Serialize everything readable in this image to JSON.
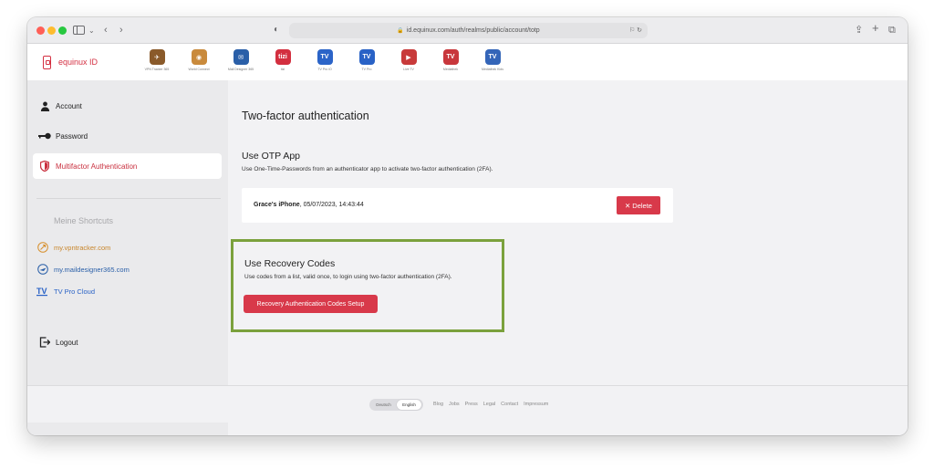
{
  "browser": {
    "url": "id.equinux.com/auth/realms/public/account/totp",
    "translate_icon": "translate-icon",
    "reload_icon": "reload-icon"
  },
  "header": {
    "brand": "equinux ID",
    "apps": [
      {
        "label": "VPN Tracker 365",
        "color": "#8a5a2a",
        "glyph": "✈"
      },
      {
        "label": "World Connect",
        "color": "#c98a3c",
        "glyph": "◉"
      },
      {
        "label": "Mail Designer 365",
        "color": "#2a5fa8",
        "glyph": "✉"
      },
      {
        "label": "tizi",
        "color": "#d32f3f",
        "glyph": "tizi"
      },
      {
        "label": "TV Pro iO",
        "color": "#2b64c8",
        "glyph": "TV"
      },
      {
        "label": "TV Pro",
        "color": "#2962c6",
        "glyph": "TV"
      },
      {
        "label": "Live TV",
        "color": "#c83a3a",
        "glyph": "▶"
      },
      {
        "label": "Mediathek",
        "color": "#c8373c",
        "glyph": "TV"
      },
      {
        "label": "Mediathek Kids",
        "color": "#3465b8",
        "glyph": "TV"
      }
    ]
  },
  "sidebar": {
    "items": [
      {
        "label": "Account",
        "icon": "person-icon"
      },
      {
        "label": "Password",
        "icon": "key-icon"
      },
      {
        "label": "Multifactor Authentication",
        "icon": "shield-icon"
      }
    ],
    "shortcuts_title": "Meine Shortcuts",
    "shortcuts": [
      {
        "label": "my.vpntracker.com",
        "color": "#d7902e",
        "icon": "vpntracker-icon"
      },
      {
        "label": "my.maildesigner365.com",
        "color": "#2a5fa8",
        "icon": "maildesigner-icon"
      },
      {
        "label": "TV Pro Cloud",
        "color": "#2962c6",
        "icon": "tvpro-icon"
      }
    ],
    "logout": "Logout"
  },
  "main": {
    "title": "Two-factor authentication",
    "otp": {
      "title": "Use OTP App",
      "description": "Use One-Time-Passwords from an authenticator app to activate two-factor authentication (2FA).",
      "device_name": "Grace's iPhone",
      "device_date": ", 05/07/2023, 14:43:44",
      "delete_label": "Delete"
    },
    "recovery": {
      "title": "Use Recovery Codes",
      "description": "Use codes from a list, valid once, to login using two-factor authentication (2FA).",
      "button_label": "Recovery Authentication Codes Setup"
    }
  },
  "footer": {
    "languages": [
      "Deutsch",
      "English"
    ],
    "links": [
      "Blog",
      "Jobs",
      "Press",
      "Legal",
      "Contact",
      "Impressum"
    ]
  },
  "colors": {
    "accent_red": "#d8394a",
    "highlight_green": "#7ba13c"
  }
}
